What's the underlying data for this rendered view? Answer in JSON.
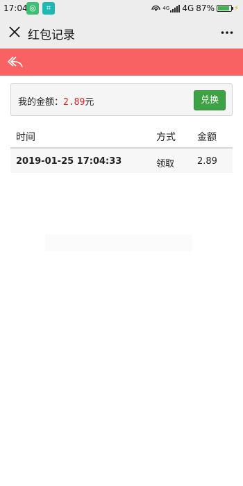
{
  "status_bar": {
    "time": "17:04",
    "network_small": "4G",
    "network": "4G",
    "battery": "87%",
    "battery_level": 0.87
  },
  "header": {
    "title": "红包记录",
    "close_icon": "close-icon",
    "more_icon": "more-icon"
  },
  "toolbar": {
    "back_icon": "back-icon",
    "accent_color": "#f96262"
  },
  "balance": {
    "label": "我的金额：",
    "amount": "2.89",
    "unit": "元",
    "exchange_button": "兑换",
    "button_color": "#3da244"
  },
  "table": {
    "headers": [
      "时间",
      "方式",
      "金额"
    ],
    "rows": [
      [
        "2019-01-25 17:04:33",
        "领取",
        "2.89"
      ]
    ]
  }
}
